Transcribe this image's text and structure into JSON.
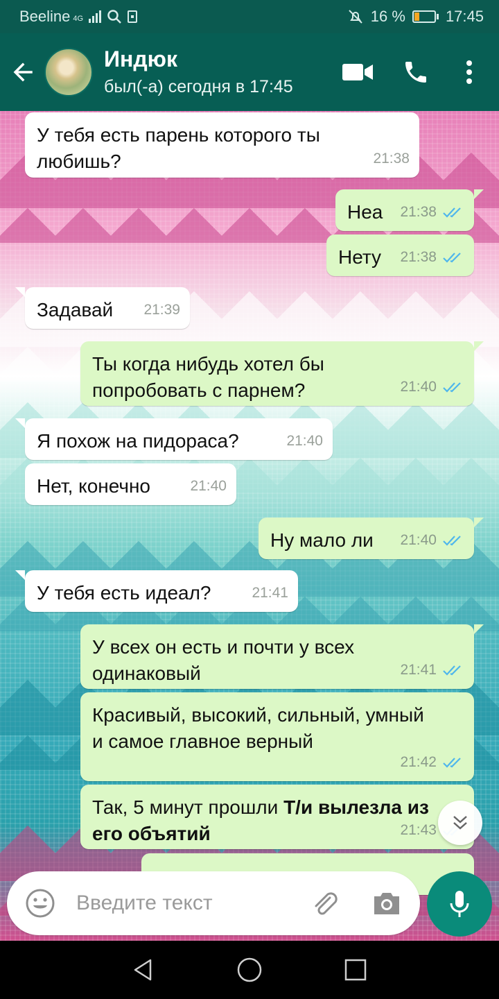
{
  "status_bar": {
    "carrier": "Beeline",
    "network": "4G",
    "battery": "16 %",
    "time": "17:45"
  },
  "header": {
    "contact_name": "Индюк",
    "last_seen": "был(-а) сегодня в 17:45",
    "accent_color": "#075e54"
  },
  "messages": [
    {
      "direction": "in",
      "text": "У тебя есть парень которого ты любишь?",
      "time": "21:38"
    },
    {
      "direction": "out",
      "text": "Неа",
      "time": "21:38",
      "read": true
    },
    {
      "direction": "out",
      "text": "Нету",
      "time": "21:38",
      "read": true
    },
    {
      "direction": "in",
      "text": "Задавай",
      "time": "21:39"
    },
    {
      "direction": "out",
      "text": "Ты когда нибудь хотел бы попробовать с парнем?",
      "time": "21:40",
      "read": true
    },
    {
      "direction": "in",
      "text": "Я похож на пидораса?",
      "time": "21:40"
    },
    {
      "direction": "in",
      "text": "Нет, конечно",
      "time": "21:40"
    },
    {
      "direction": "out",
      "text": "Ну мало ли",
      "time": "21:40",
      "read": true
    },
    {
      "direction": "in",
      "text": "У тебя есть идеал?",
      "time": "21:41"
    },
    {
      "direction": "out",
      "text": "У всех он есть и почти у всех одинаковый",
      "time": "21:41",
      "read": true
    },
    {
      "direction": "out",
      "text": "Красивый, высокий, сильный, умный и самое главное верный",
      "time": "21:42",
      "read": true
    },
    {
      "direction": "out",
      "text_plain": "Так, 5 минут прошли ",
      "text_bold": "Т/и вылезла из его объятий",
      "time": "21:43",
      "read": true
    }
  ],
  "input": {
    "placeholder": "Введите текст"
  },
  "icons": {
    "back": "arrow-left-icon",
    "video": "video-camera-icon",
    "call": "phone-icon",
    "menu": "more-vert-icon",
    "emoji": "emoji-icon",
    "attach": "paperclip-icon",
    "camera": "camera-icon",
    "mic": "microphone-icon",
    "scroll": "double-chevron-down-icon"
  },
  "colors": {
    "incoming_bubble": "#ffffff",
    "outgoing_bubble": "#dcf8c6",
    "read_ticks": "#4fb6ec",
    "mic_button": "#0a8b7a"
  }
}
